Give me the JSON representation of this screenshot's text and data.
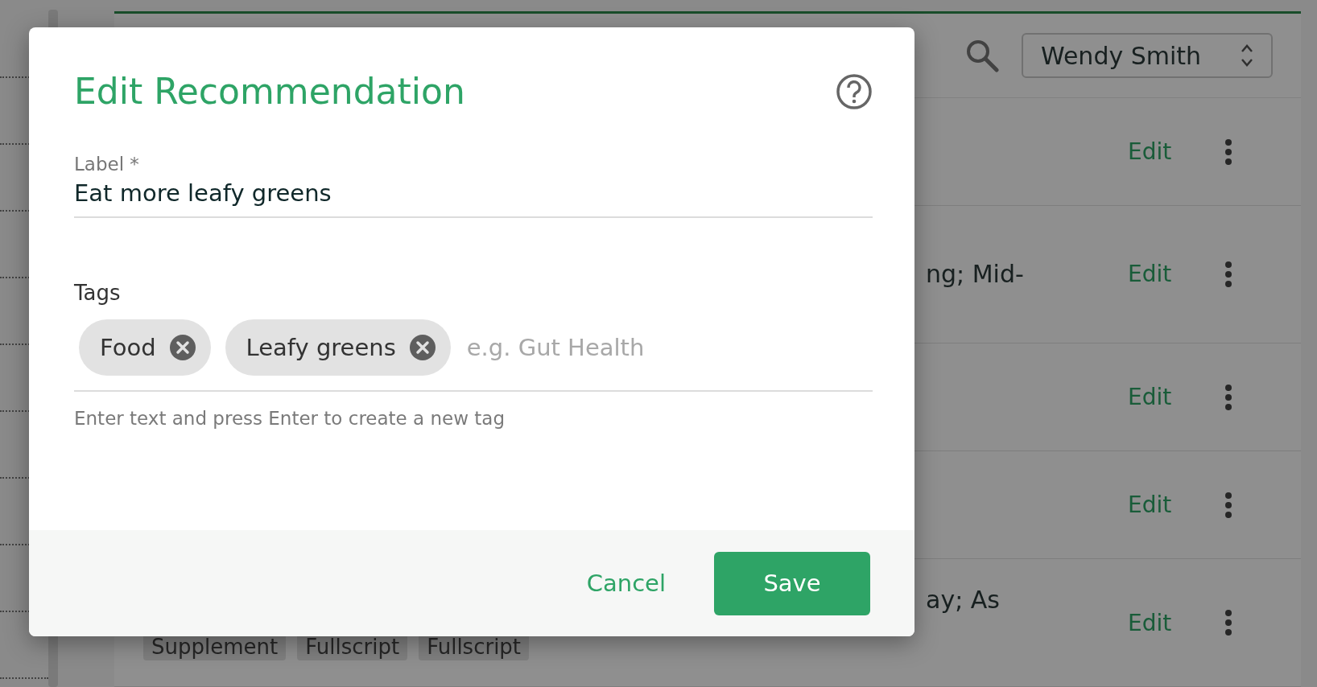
{
  "background": {
    "user_select": {
      "value": "Wendy Smith"
    },
    "rows": [
      {
        "action": "Edit"
      },
      {
        "text": "ng; Mid-",
        "action": "Edit"
      },
      {
        "action": "Edit"
      },
      {
        "action": "Edit"
      },
      {
        "text": "ay; As",
        "tags": [
          "Supplement",
          "Fullscript",
          "Fullscript"
        ],
        "action": "Edit"
      }
    ]
  },
  "dialog": {
    "title": "Edit Recommendation",
    "label_field": {
      "label": "Label *",
      "value": "Eat more leafy greens"
    },
    "tags_field": {
      "label": "Tags",
      "tags": [
        "Food",
        "Leafy greens"
      ],
      "placeholder": "e.g. Gut Health",
      "helper": "Enter text and press Enter to create a new tag"
    },
    "buttons": [
      {
        "label": "Cancel",
        "kind": "text"
      },
      {
        "label": "Save",
        "kind": "primary"
      }
    ]
  }
}
